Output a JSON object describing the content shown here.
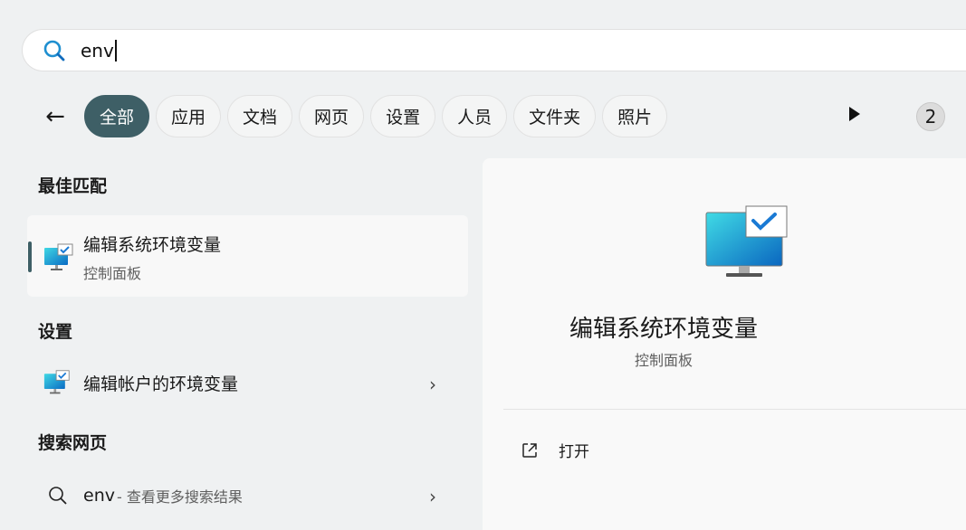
{
  "search": {
    "value": "env"
  },
  "filters": [
    "全部",
    "应用",
    "文档",
    "网页",
    "设置",
    "人员",
    "文件夹",
    "照片"
  ],
  "result_count": "2",
  "left": {
    "best_match_heading": "最佳匹配",
    "best_match": {
      "title": "编辑系统环境变量",
      "subtitle": "控制面板"
    },
    "settings_heading": "设置",
    "settings_item": "编辑帐户的环境变量",
    "web_heading": "搜索网页",
    "web_item": {
      "query": "env",
      "suffix": " - 查看更多搜索结果"
    }
  },
  "detail": {
    "title": "编辑系统环境变量",
    "subtitle": "控制面板",
    "open_label": "打开"
  }
}
